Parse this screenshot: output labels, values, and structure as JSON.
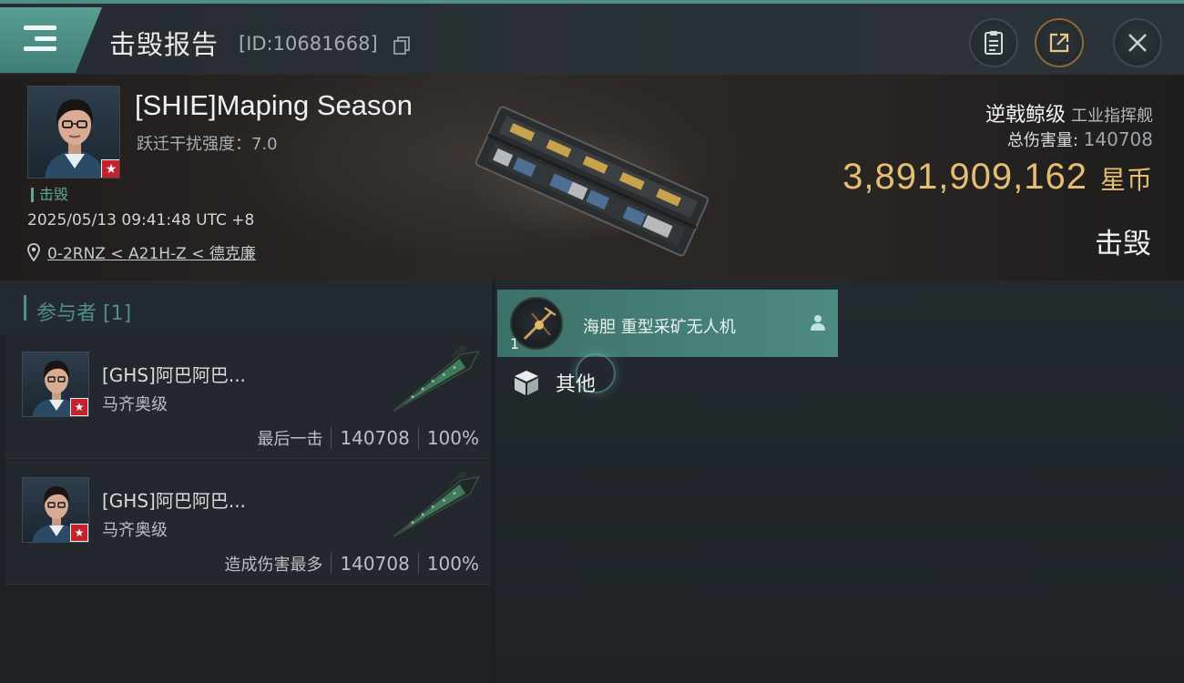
{
  "header": {
    "title": "击毁报告",
    "report_id": "[ID:10681668]"
  },
  "victim": {
    "name": "[SHIE]Maping Season",
    "warp_strength": "跃迁干扰强度：7.0",
    "result_tag": "击毁",
    "datetime": "2025/05/13 09:41:48 UTC +8",
    "location": "0-2RNZ < A21H-Z < 德克廉",
    "ship_class": "逆戟鲸级",
    "ship_category": "工业指挥舰",
    "total_damage_label": "总伤害量:",
    "total_damage": "140708",
    "isk_value": "3,891,909,162",
    "isk_unit": "星币",
    "status": "击毁"
  },
  "participants": {
    "title": "参与者 [1]",
    "items": [
      {
        "name": "[GHS]阿巴阿巴...",
        "ship": "马齐奥级",
        "label": "最后一击",
        "damage": "140708",
        "percent": "100%"
      },
      {
        "name": "[GHS]阿巴阿巴...",
        "ship": "马齐奥级",
        "label": "造成伤害最多",
        "damage": "140708",
        "percent": "100%"
      }
    ]
  },
  "items": {
    "row1": {
      "qty": "1",
      "name": "海胆 重型采矿无人机"
    },
    "other_label": "其他"
  },
  "colors": {
    "accent": "#4f8f86",
    "isk": "#e6be72",
    "badge_red": "#c3242c"
  }
}
